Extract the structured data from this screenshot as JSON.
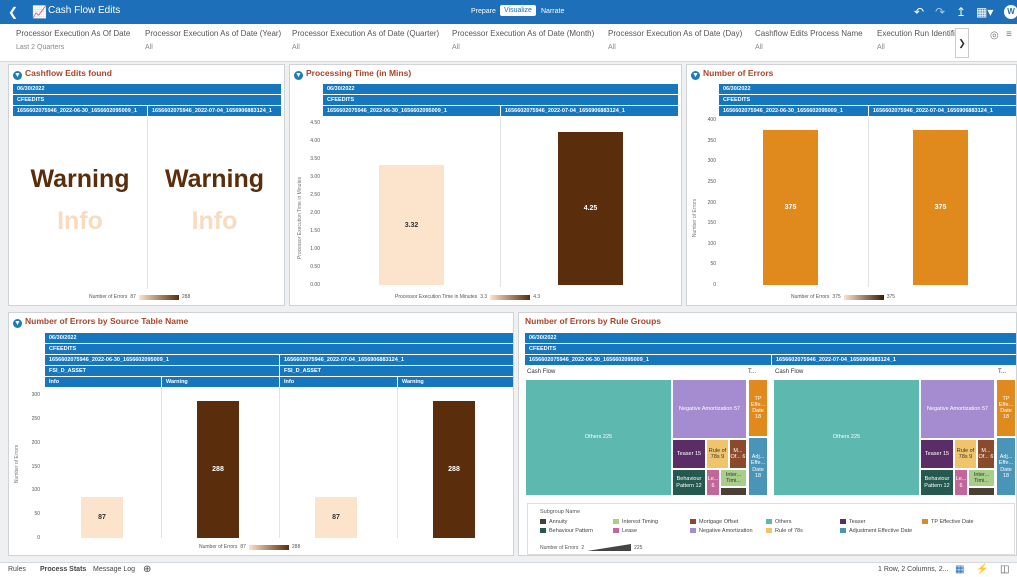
{
  "app": {
    "title": "Cash Flow Edits",
    "tabs": [
      "Prepare",
      "Visualize",
      "Narrate"
    ],
    "active_tab": "Visualize",
    "avatar": "W"
  },
  "filters": [
    {
      "label": "Processor Execution As Of Date",
      "value": "Last 2 Quarters"
    },
    {
      "label": "Processor Execution As of Date (Year)",
      "value": "All"
    },
    {
      "label": "Processor Execution As of Date (Quarter)",
      "value": "All"
    },
    {
      "label": "Processor Execution As of Date (Month)",
      "value": "All"
    },
    {
      "label": "Processor Execution As of Date (Day)",
      "value": "All"
    },
    {
      "label": "Cashflow Edits Process Name",
      "value": "All"
    },
    {
      "label": "Execution Run Identifier",
      "value": "All"
    }
  ],
  "common": {
    "date": "06/30/2022",
    "process": "CFEEDITS",
    "run1": "1656602075946_2022-06-30_1656602095009_1",
    "run2": "1656602075946_2022-07-04_1656906883124_1"
  },
  "panel1": {
    "title": "Cashflow Edits found",
    "warning": "Warning",
    "info": "Info",
    "legend_label": "Number of Errors",
    "legend_min": "87",
    "legend_max": "288"
  },
  "panel2": {
    "title": "Processing Time (in Mins)",
    "ylabel": "Processor Execution Time in Minutes",
    "legend_label": "Processor Execution Time in Minutes",
    "legend_min": "3.3",
    "legend_max": "4.3"
  },
  "panel3": {
    "title": "Number of Errors",
    "ylabel": "Number of Errors",
    "legend_label": "Number of Errors",
    "legend_min": "375",
    "legend_max": "375"
  },
  "panel4": {
    "title": "Number of Errors by Source Table Name",
    "ylabel": "Number of Errors",
    "table": "FSI_D_ASSET",
    "col_info": "Info",
    "col_warning": "Warning",
    "legend_label": "Number of Errors",
    "legend_min": "87",
    "legend_max": "288"
  },
  "panel5": {
    "title": "Number of Errors by Rule Groups",
    "group1": "Cash Flow",
    "group2": "T...",
    "tiles": {
      "others": "Others 225",
      "neg_am": "Negative Amortization 57",
      "teaser": "Teaser 15",
      "rule78": "Rule of 78s 9",
      "mort_off": "M... Of... 6",
      "behav": "Behaviour Pattern 12",
      "lease": "Le... 6",
      "inter": "Inter... Timi...",
      "tp_eff": "TP Effe... Date 18",
      "adj_eff": "Adj... Effe... Date 18"
    },
    "subgroup_title": "Subgroup Name",
    "subgroups": [
      {
        "name": "Annuity",
        "color": "#4a3f35"
      },
      {
        "name": "Interest Timing",
        "color": "#a8cf8a"
      },
      {
        "name": "Mortgage Offset",
        "color": "#8b4a2b"
      },
      {
        "name": "Others",
        "color": "#5db8b0"
      },
      {
        "name": "Teaser",
        "color": "#5b2d66"
      },
      {
        "name": "TP Effective Date",
        "color": "#e08a1e"
      },
      {
        "name": "Behaviour Pattern",
        "color": "#25594f"
      },
      {
        "name": "Lease",
        "color": "#c3679a"
      },
      {
        "name": "Negative Amortization",
        "color": "#a58cd1"
      },
      {
        "name": "Rule of 78s",
        "color": "#f0c46a"
      },
      {
        "name": "Adjustment Effective Date",
        "color": "#4a94b8"
      }
    ],
    "legend_label": "Number of Errors",
    "legend_min": "2",
    "legend_max": "225"
  },
  "bottom": {
    "tabs": [
      "Rules",
      "Process Stats",
      "Message Log"
    ],
    "active": "Process Stats",
    "status": "1 Row, 2 Columns, 2..."
  },
  "chart_data": [
    {
      "type": "bar",
      "title": "Processing Time (in Mins)",
      "categories": [
        "1656602075946_2022-06-30_1656602095009_1",
        "1656602075946_2022-07-04_1656906883124_1"
      ],
      "values": [
        3.32,
        4.25
      ],
      "ylabel": "Processor Execution Time in Minutes",
      "ylim": [
        0,
        4.5
      ],
      "yticks": [
        "4.50",
        "4.00",
        "3.50",
        "3.00",
        "2.50",
        "2.00",
        "1.50",
        "1.00",
        "0.50",
        "0.00"
      ]
    },
    {
      "type": "bar",
      "title": "Number of Errors",
      "categories": [
        "1656602075946_2022-06-30_1656602095009_1",
        "1656602075946_2022-07-04_1656906883124_1"
      ],
      "values": [
        375,
        375
      ],
      "ylabel": "Number of Errors",
      "ylim": [
        0,
        400
      ],
      "yticks": [
        "400",
        "350",
        "300",
        "250",
        "200",
        "150",
        "100",
        "50",
        "0"
      ]
    },
    {
      "type": "bar",
      "title": "Number of Errors by Source Table Name",
      "categories": [
        "Info",
        "Warning",
        "Info",
        "Warning"
      ],
      "values": [
        87,
        288,
        87,
        288
      ],
      "ylabel": "Number of Errors",
      "ylim": [
        0,
        300
      ],
      "yticks": [
        "300",
        "250",
        "200",
        "150",
        "100",
        "50",
        "0"
      ]
    }
  ]
}
